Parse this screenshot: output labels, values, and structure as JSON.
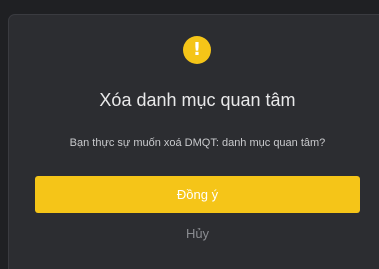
{
  "dialog": {
    "icon": "warning-exclamation-icon",
    "icon_glyph": "!",
    "title": "Xóa danh mục quan tâm",
    "message": "Bạn thực sự muốn xoá DMQT: danh mục quan tâm?",
    "confirm_label": "Đồng ý",
    "cancel_label": "Hủy"
  },
  "colors": {
    "accent": "#f5c518",
    "dialog_bg": "#2c2d31",
    "backdrop": "#1f2023"
  }
}
